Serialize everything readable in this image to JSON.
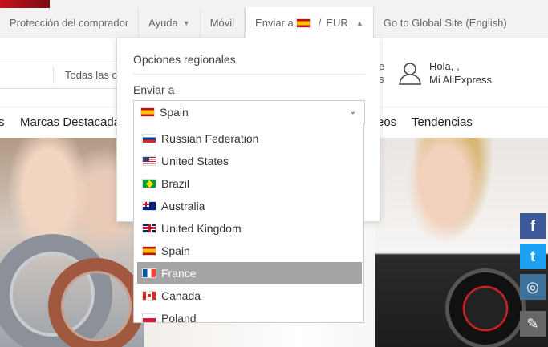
{
  "utilbar": {
    "items": [
      {
        "label": "Protección del comprador"
      },
      {
        "label": "Ayuda"
      },
      {
        "label": "Móvil"
      },
      {
        "label": "Enviar a"
      },
      {
        "label": "Go to Global Site (English)"
      }
    ],
    "ship_separator": "/",
    "currency": "EUR"
  },
  "header": {
    "search_category": "Todas las c",
    "wishlist_fragment_1": "e",
    "wishlist_fragment_2": "s",
    "account_greeting": "Hola, ,",
    "account_link": "Mi AliExpress"
  },
  "nav": {
    "items": [
      "s",
      "Marcas Destacadas",
      "eos",
      "Tendencias"
    ]
  },
  "dropdown": {
    "title": "Opciones regionales",
    "ship_label": "Enviar a",
    "selected_country": "Spain",
    "countries": [
      {
        "name": "Russian Federation",
        "flag": "ru"
      },
      {
        "name": "United States",
        "flag": "us"
      },
      {
        "name": "Brazil",
        "flag": "br"
      },
      {
        "name": "Australia",
        "flag": "au"
      },
      {
        "name": "United Kingdom",
        "flag": "gb"
      },
      {
        "name": "Spain",
        "flag": "es"
      },
      {
        "name": "France",
        "flag": "fr"
      },
      {
        "name": "Canada",
        "flag": "ca"
      },
      {
        "name": "Poland",
        "flag": "pl"
      }
    ],
    "highlighted_country": "France"
  },
  "social": {
    "facebook_glyph": "f",
    "twitter_glyph": "t",
    "instagram_glyph": "◎",
    "edit_glyph": "✎"
  }
}
